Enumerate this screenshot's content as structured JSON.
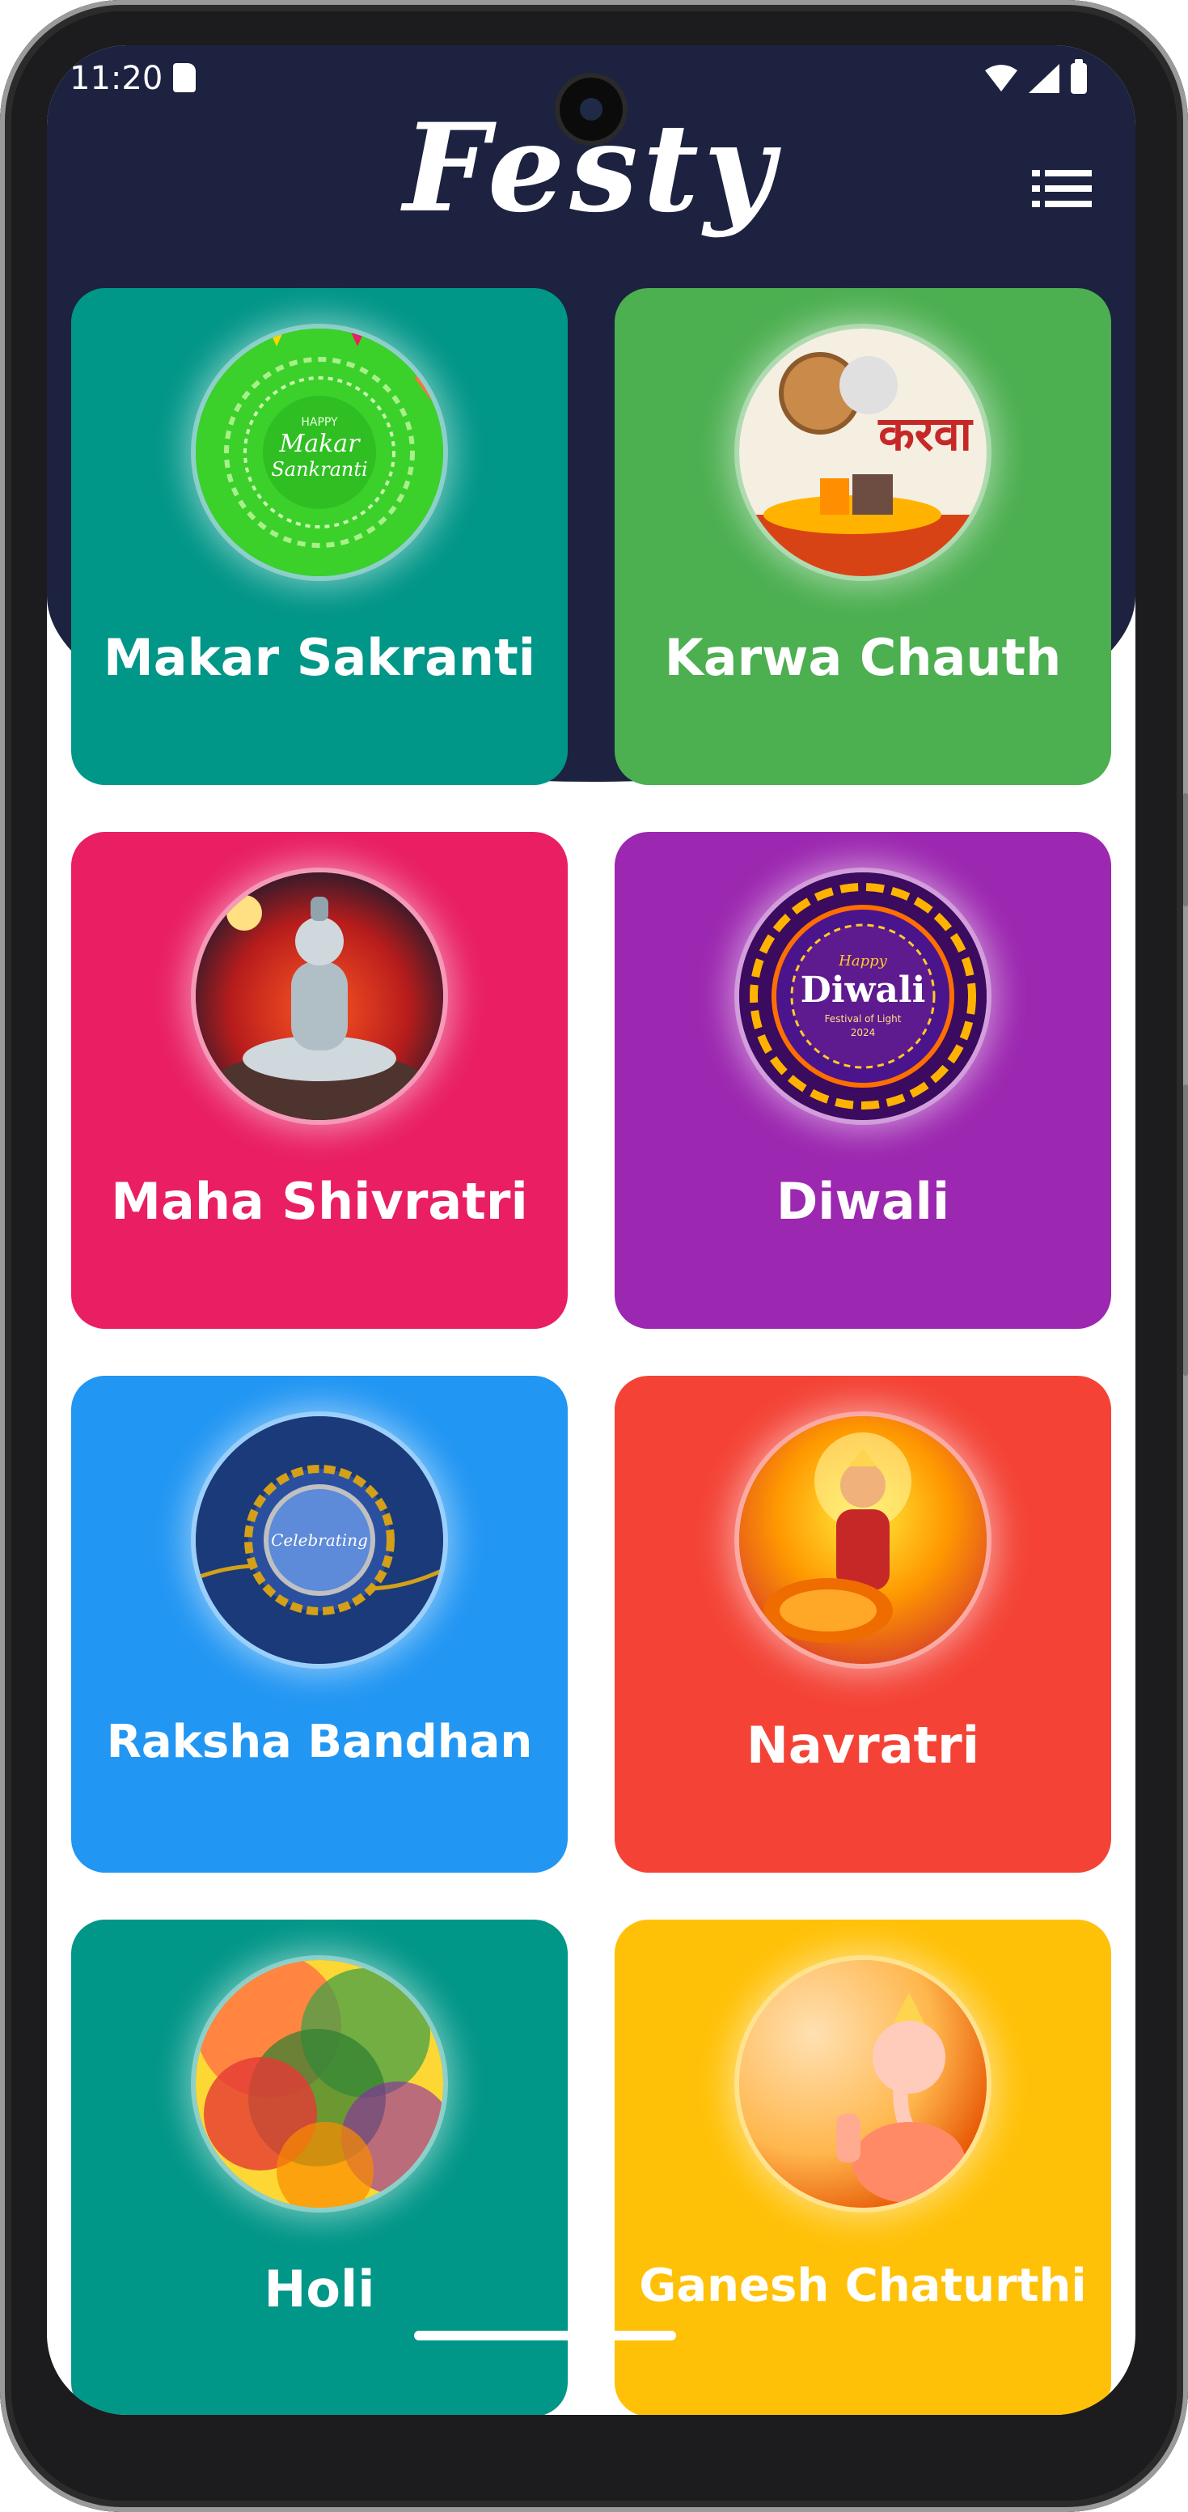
{
  "status_bar": {
    "time": "11:20"
  },
  "app": {
    "title": "Festy"
  },
  "colors": {
    "header": "#1c2240",
    "teal": "#009688",
    "green": "#4caf50",
    "pink": "#e91e63",
    "purple": "#9c27b0",
    "blue": "#2196f3",
    "red": "#f44336",
    "amber": "#ffc107"
  },
  "festivals": [
    {
      "label": "Makar Sakranti",
      "color": "#009688",
      "image": "makar-sankranti-image"
    },
    {
      "label": "Karwa Chauth",
      "color": "#4caf50",
      "image": "karwa-chauth-image"
    },
    {
      "label": "Maha Shivratri",
      "color": "#e91e63",
      "image": "shiva-meditating-image"
    },
    {
      "label": "Diwali",
      "color": "#9c27b0",
      "image": "diwali-mandala-image"
    },
    {
      "label": "Raksha Bandhan",
      "color": "#2196f3",
      "image": "rakhi-image"
    },
    {
      "label": "Navratri",
      "color": "#f44336",
      "image": "durga-image"
    },
    {
      "label": "Holi",
      "color": "#009688",
      "image": "holi-colors-image"
    },
    {
      "label": "Ganesh Chaturthi",
      "color": "#ffc107",
      "image": "ganesha-image"
    }
  ],
  "thumb_text": {
    "makar_line1": "HAPPY",
    "makar_line2": "Makar",
    "makar_line3": "Sankranti",
    "karwa_text": "करवा",
    "diwali_line1": "Happy",
    "diwali_line2": "Diwali",
    "diwali_line3": "Festival of Light",
    "diwali_line4": "2024",
    "rakhi_text": "Celebrating"
  }
}
